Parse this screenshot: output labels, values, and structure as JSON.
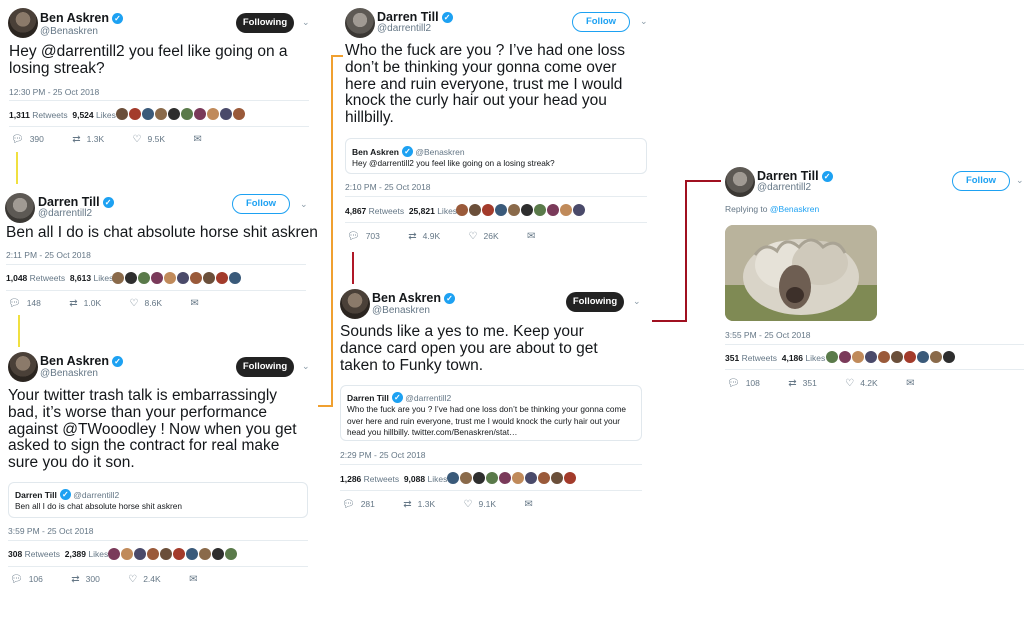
{
  "follow_label": "Follow",
  "following_label": "Following",
  "likes_label": "Likes",
  "retweets_label": "Retweets",
  "replying_to_label": "Replying to",
  "tweets": {
    "t1": {
      "name": "Ben Askren",
      "handle": "@Benaskren",
      "text": "Hey @darrentill2 you feel like going on a losing streak?",
      "time": "12:30 PM - 25 Oct 2018",
      "retweets": "1,311",
      "likes": "9,524",
      "replies": "390",
      "rts_short": "1.3K",
      "likes_short": "9.5K"
    },
    "t2": {
      "name": "Darren Till",
      "handle": "@darrentill2",
      "text": "Ben all I do is chat absolute horse shit askren",
      "time": "2:11 PM - 25 Oct 2018",
      "retweets": "1,048",
      "likes": "8,613",
      "replies": "148",
      "rts_short": "1.0K",
      "likes_short": "8.6K"
    },
    "t3": {
      "name": "Ben Askren",
      "handle": "@Benaskren",
      "text": "Your twitter trash talk is embarrassingly bad, it’s worse than your performance against @TWooodley ! Now when you get asked to sign the contract for real make sure you do it son.",
      "quote_name": "Darren Till",
      "quote_handle": "@darrentill2",
      "quote_text": "Ben all I do is chat absolute horse shit askren",
      "time": "3:59 PM - 25 Oct 2018",
      "retweets": "308",
      "likes": "2,389",
      "replies": "106",
      "rts_short": "300",
      "likes_short": "2.4K"
    },
    "t4": {
      "name": "Darren Till",
      "handle": "@darrentill2",
      "text": "Who the fuck are you ? I’ve had one loss don’t be thinking your gonna come over here and ruin everyone, trust me I would knock the curly hair out your head you hillbilly.",
      "quote_name": "Ben Askren",
      "quote_handle": "@Benaskren",
      "quote_text": "Hey @darrentill2 you feel like going on a losing streak?",
      "time": "2:10 PM - 25 Oct 2018",
      "retweets": "4,867",
      "likes": "25,821",
      "replies": "703",
      "rts_short": "4.9K",
      "likes_short": "26K"
    },
    "t5": {
      "name": "Ben Askren",
      "handle": "@Benaskren",
      "text": "Sounds like a yes to me.  Keep your dance card open you are about to get taken to Funky town.",
      "quote_name": "Darren Till",
      "quote_handle": "@darrentill2",
      "quote_text": "Who the fuck are you ? I’ve had one loss don’t be thinking your gonna come over here and ruin everyone, trust me I would knock the curly hair out your head you hillbilly. twitter.com/Benaskren/stat…",
      "time": "2:29 PM - 25 Oct 2018",
      "retweets": "1,286",
      "likes": "9,088",
      "replies": "281",
      "rts_short": "1.3K",
      "likes_short": "9.1K"
    },
    "t6": {
      "name": "Darren Till",
      "handle": "@darrentill2",
      "reply_to": "@Benaskren",
      "time": "3:55 PM - 25 Oct 2018",
      "retweets": "351",
      "likes": "4,186",
      "replies": "108",
      "rts_short": "351",
      "likes_short": "4.2K"
    }
  },
  "colors": {
    "verified": "#1da1f2",
    "thread_yellow": "#f0e040",
    "thread_orange": "#f0a030",
    "thread_red": "#b01828",
    "thread_darkred": "#a01020"
  }
}
